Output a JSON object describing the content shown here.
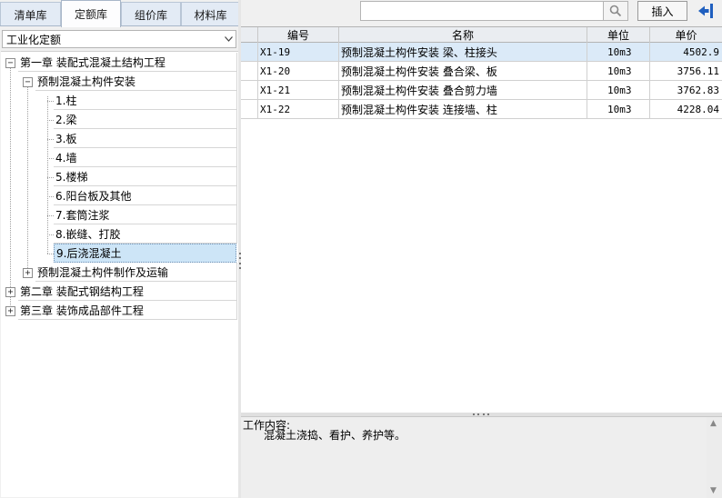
{
  "tabs": [
    {
      "label": "清单库",
      "active": false
    },
    {
      "label": "定额库",
      "active": true
    },
    {
      "label": "组价库",
      "active": false
    },
    {
      "label": "材料库",
      "active": false
    }
  ],
  "library_select": {
    "value": "工业化定额"
  },
  "toolbar": {
    "search_value": "",
    "insert_label": "插入"
  },
  "tree": {
    "chapter1": "第一章 装配式混凝土结构工程",
    "section1": "预制混凝土构件安装",
    "items": [
      "1.柱",
      "2.梁",
      "3.板",
      "4.墙",
      "5.楼梯",
      "6.阳台板及其他",
      "7.套筒注浆",
      "8.嵌缝、打胶",
      "9.后浇混凝土"
    ],
    "section2": "预制混凝土构件制作及运输",
    "chapter2": "第二章 装配式钢结构工程",
    "chapter3": "第三章 装饰成品部件工程"
  },
  "grid": {
    "headers": {
      "code": "编号",
      "name": "名称",
      "unit": "单位",
      "price": "单价"
    },
    "rows": [
      {
        "code": "X1-19",
        "name": "预制混凝土构件安装 梁、柱接头",
        "unit": "10m3",
        "price": "4502.9"
      },
      {
        "code": "X1-20",
        "name": "预制混凝土构件安装 叠合梁、板",
        "unit": "10m3",
        "price": "3756.11"
      },
      {
        "code": "X1-21",
        "name": "预制混凝土构件安装 叠合剪力墙",
        "unit": "10m3",
        "price": "3762.83"
      },
      {
        "code": "X1-22",
        "name": "预制混凝土构件安装 连接墙、柱",
        "unit": "10m3",
        "price": "4228.04"
      }
    ]
  },
  "description": {
    "label": "工作内容:",
    "text": "混凝土浇捣、看护、养护等。"
  },
  "colors": {
    "selected_row": "#dbeaf8",
    "tree_selected": "#cde5f7",
    "active_tab": "#fdfdfe",
    "tab": "#e3ebf5",
    "exit_icon": "#1f5fbf"
  }
}
